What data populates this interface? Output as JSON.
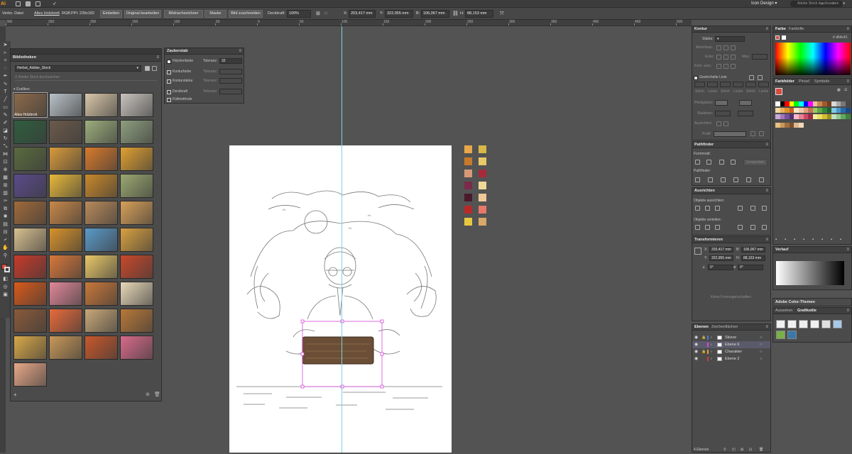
{
  "app": {
    "logo": "Ai",
    "workspace": "Icon Design",
    "stock_search_placeholder": "Adobe Stock durchsuchen",
    "accent": "#f29b24"
  },
  "control_bar": {
    "selection": "Verkn. Datei",
    "filename": "Altes Holzbrett",
    "color_mode": "RGB",
    "ppi": "PPI: 239x182",
    "embed": "Einbetten",
    "edit_original": "Original bearbeiten",
    "image_trace": "Bildnachzeichner",
    "mask": "Maske",
    "crop": "Bild zuschneiden",
    "opacity_label": "Deckkraft:",
    "opacity_value": "100%",
    "x_label": "X:",
    "x_value": "203,417 mm",
    "y_label": "Y:",
    "y_value": "322,955 mm",
    "b_label": "B:",
    "b_value": "106,067 mm",
    "h_label": "H:",
    "h_value": "88,153 mm"
  },
  "ruler": {
    "ticks": [
      "300",
      "250",
      "200",
      "150",
      "100",
      "50",
      "0",
      "50",
      "100",
      "150",
      "200",
      "250",
      "300",
      "350",
      "400",
      "450",
      "500"
    ]
  },
  "libraries": {
    "title": "Bibliotheken",
    "library_name": "Herbst_Adobe_Stock",
    "search_placeholder": "Adobe Stock durchsuchen",
    "section": "Grafiken",
    "first_item_label": "Altes Holzbrett",
    "thumbs": [
      "#8c6a4a",
      "#b9c2c8",
      "#d8c6a8",
      "#c9c3bd",
      "#2f5e3e",
      "#6b5a4a",
      "#9cae7c",
      "#8e9e7e",
      "#5a6b3e",
      "#d89a3a",
      "#d97a2a",
      "#e0a030",
      "#5a4a8a",
      "#e8b83a",
      "#c8882a",
      "#9aa870",
      "#a06a3a",
      "#c88848",
      "#b88a5a",
      "#d8a058",
      "#d8c090",
      "#d8922a",
      "#5a9ac8",
      "#d8a040",
      "#c83a2a",
      "#d8783a",
      "#e8c868",
      "#c8482a",
      "#d85a1a",
      "#e08898",
      "#c8783a",
      "#e8d8b8",
      "#8a5a3a",
      "#e86a3a",
      "#c8a878",
      "#b87838",
      "#d8a848",
      "#c89858",
      "#c8582a",
      "#d86a8a",
      "#e8a888"
    ]
  },
  "zauberstab": {
    "title": "Zauberstab",
    "fill_label": "Flächenfarbe",
    "fill_tol_label": "Toleranz:",
    "fill_tol_value": "32",
    "stroke_color_label": "Konturfarbe",
    "stroke_color_tol_label": "Toleranz:",
    "stroke_weight_label": "Konturstärke",
    "stroke_weight_tol_label": "Toleranz:",
    "opacity_label": "Deckkraft",
    "opacity_tol_label": "Toleranz:",
    "blend_label": "Füllmethode"
  },
  "swatches_canvas": [
    "#e8a84a",
    "#d8b848",
    "#c87a2a",
    "#e8c868",
    "#d89878",
    "#a82a3a",
    "#7a2a4a",
    "#f0d898",
    "#4a1a2a",
    "#f0c898",
    "#b82a2a",
    "#e87868",
    "#e8c840",
    "#d8a868"
  ],
  "kontur": {
    "title": "Kontur",
    "weight_label": "Stärke:",
    "cap_label": "Abschluss:",
    "corner_label": "Ecke:",
    "limit_label": "Max.:",
    "align_label": "Kont. ausr.:",
    "dashed_label": "Gestrichelte Linie",
    "dash_labels": [
      "Strich",
      "Lücke",
      "Strich",
      "Lücke",
      "Strich",
      "Lücke"
    ],
    "arrowheads_label": "Pfeilspitzen:",
    "scale_label": "Skalieren:",
    "align2_label": "Ausrichten:",
    "profile_label": "Profil:"
  },
  "pathfinder": {
    "title": "Pathfinder",
    "shape_modes": "Formmodi:",
    "expand": "Umwandeln",
    "pathfinders": "Pathfinder:"
  },
  "ausrichten": {
    "title": "Ausrichten",
    "align_objects": "Objekte ausrichten:",
    "distribute_objects": "Objekte verteilen:"
  },
  "transform": {
    "title": "Transformieren",
    "x_label": "X:",
    "x_value": "203,417 mm",
    "b_label": "B:",
    "b_value": "106,067 mm",
    "y_label": "Y:",
    "y_value": "322,955 mm",
    "h_label": "H:",
    "h_value": "88,153 mm",
    "angle_value": "0°",
    "shear_value": "0°",
    "no_props": "Keine Formeigenschaften"
  },
  "layers": {
    "tab_layers": "Ebenen",
    "tab_artboards": "Zeichenflächen",
    "rows": [
      {
        "name": "Skizze",
        "color": "#4a7adf"
      },
      {
        "name": "Ebene 6",
        "color": "#d84ad8"
      },
      {
        "name": "Charakter",
        "color": "#e0a030"
      },
      {
        "name": "Ebene 2",
        "color": "#d83a3a"
      }
    ],
    "count": "4 Ebenen"
  },
  "farbe": {
    "tab_color": "Farbe",
    "tab_guide": "Farbhilfe",
    "hex": "d64c41"
  },
  "farbfelder": {
    "tab_swatches": "Farbfelder",
    "tab_brushes": "Pinsel",
    "tab_symbols": "Symbole",
    "grid": [
      "#ffffff",
      "#000000",
      "#ff0000",
      "#ffff00",
      "#00ff00",
      "#00ffff",
      "#0000ff",
      "#ff00ff",
      "#e8c0a0",
      "#c88850",
      "#a05a2a",
      "#704020",
      "#d8d8d8",
      "#a8a8a8",
      "#787878",
      "#484848",
      "#f0d8a0",
      "#e8b060",
      "#e09030",
      "#c86020",
      "#f8e8c8",
      "#f0c8a8",
      "#e0a080",
      "#c87058",
      "#9ac860",
      "#60a848",
      "#308838",
      "#206028",
      "#80c8e8",
      "#4898c8",
      "#2868a8",
      "#184888",
      "#c8a8d8",
      "#a078b8",
      "#785098",
      "#503070",
      "#f8b8c8",
      "#e88098",
      "#d04868",
      "#a02848",
      "#f0f0a0",
      "#e8e060",
      "#d0c030",
      "#a09020",
      "#c0e0c0",
      "#90c890",
      "#60a860",
      "#408040"
    ]
  },
  "verlauf": {
    "title": "Verlauf"
  },
  "color_themes": {
    "title": "Adobe Color-Themen"
  },
  "grafikstile": {
    "tab_appearance": "Aussehen",
    "tab_styles": "Grafikstile"
  }
}
